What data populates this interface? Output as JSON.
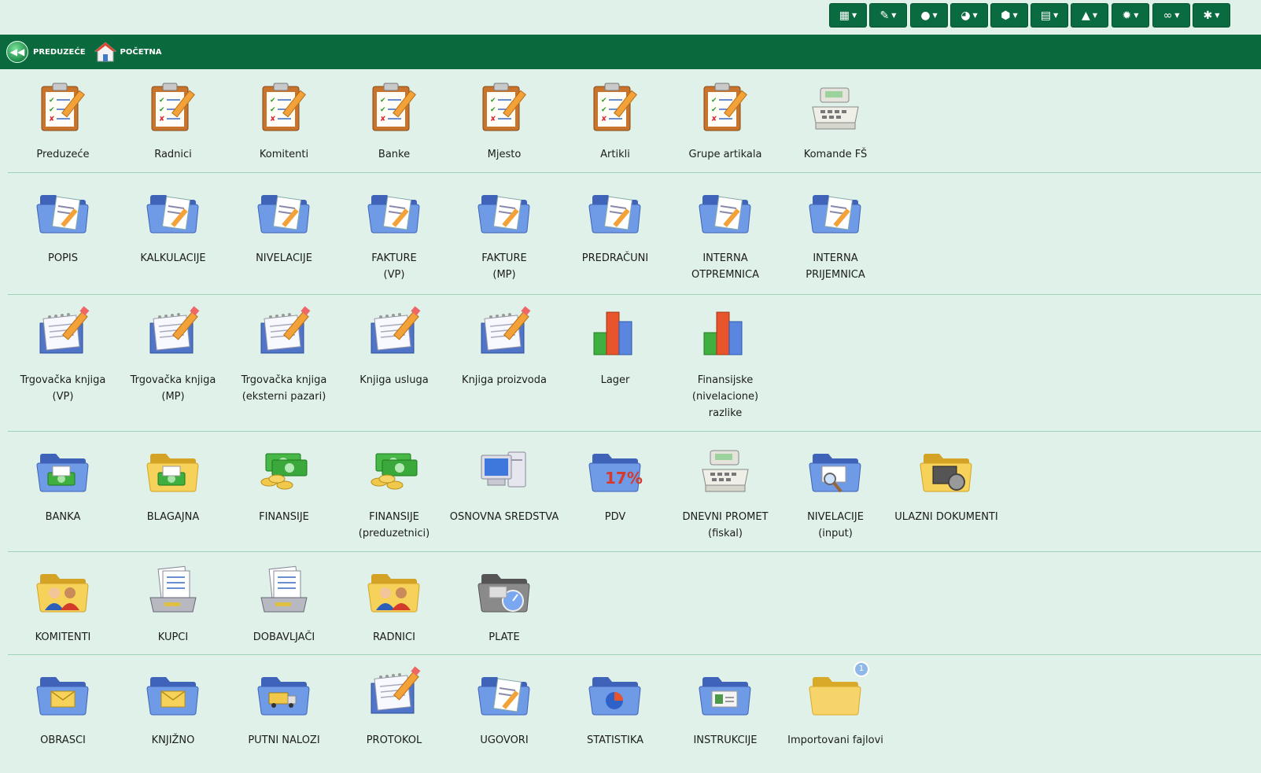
{
  "toolbar": {
    "buttons": [
      {
        "name": "calculator-menu-button",
        "icon": "calculator-icon",
        "glyph": "▦"
      },
      {
        "name": "edit-menu-button",
        "icon": "pencil-icon",
        "glyph": "✎"
      },
      {
        "name": "user-menu-button",
        "icon": "user-icon",
        "glyph": "●"
      },
      {
        "name": "chart-menu-button",
        "icon": "pie-chart-icon",
        "glyph": "◕"
      },
      {
        "name": "package-menu-button",
        "icon": "cube-icon",
        "glyph": "⬢"
      },
      {
        "name": "book-menu-button",
        "icon": "book-icon",
        "glyph": "▤"
      },
      {
        "name": "warning-menu-button",
        "icon": "warning-icon",
        "glyph": "▲"
      },
      {
        "name": "settings-menu-button",
        "icon": "gear-icon",
        "glyph": "✹"
      },
      {
        "name": "link-menu-button",
        "icon": "link-icon",
        "glyph": "∞"
      },
      {
        "name": "asterisk-menu-button",
        "icon": "asterisk-icon",
        "glyph": "✱"
      }
    ]
  },
  "nav": {
    "back_label": "PREDUZEĆE",
    "home_label": "POČETNA"
  },
  "rows": [
    {
      "items": [
        {
          "label": "Preduzeće",
          "icon": "clipboard-checklist-icon"
        },
        {
          "label": "Radnici",
          "icon": "clipboard-checklist-icon"
        },
        {
          "label": "Komitenti",
          "icon": "clipboard-checklist-icon"
        },
        {
          "label": "Banke",
          "icon": "clipboard-checklist-icon"
        },
        {
          "label": "Mjesto",
          "icon": "clipboard-checklist-icon"
        },
        {
          "label": "Artikli",
          "icon": "clipboard-checklist-icon"
        },
        {
          "label": "Grupe artikala",
          "icon": "clipboard-checklist-icon"
        },
        {
          "label": "Komande FŠ",
          "icon": "cash-register-icon"
        }
      ]
    },
    {
      "items": [
        {
          "label": "POPIS",
          "icon": "folder-document-icon"
        },
        {
          "label": "KALKULACIJE",
          "icon": "folder-document-icon"
        },
        {
          "label": "NIVELACIJE",
          "icon": "folder-document-icon"
        },
        {
          "label": "FAKTURE\n(VP)",
          "icon": "folder-document-icon"
        },
        {
          "label": "FAKTURE\n(MP)",
          "icon": "folder-document-icon"
        },
        {
          "label": "PREDRAČUNI",
          "icon": "folder-document-icon"
        },
        {
          "label": "INTERNA\nOTPREMNICA",
          "icon": "folder-document-icon"
        },
        {
          "label": "INTERNA\nPRIJEMNICA",
          "icon": "folder-document-icon"
        }
      ]
    },
    {
      "items": [
        {
          "label": "Trgovačka knjiga\n(VP)",
          "icon": "notebook-pencil-icon"
        },
        {
          "label": "Trgovačka knjiga\n(MP)",
          "icon": "notebook-pencil-icon"
        },
        {
          "label": "Trgovačka knjiga\n(eksterni pazari)",
          "icon": "notebook-pencil-icon"
        },
        {
          "label": "Knjiga usluga",
          "icon": "notebook-pencil-icon"
        },
        {
          "label": "Knjiga proizvoda",
          "icon": "notebook-pencil-icon"
        },
        {
          "label": "Lager",
          "icon": "bar-chart-icon"
        },
        {
          "label": "Finansijske\n(nivelacione)\nrazlike",
          "icon": "bar-chart-icon"
        }
      ]
    },
    {
      "items": [
        {
          "label": "BANKA",
          "icon": "folder-money-icon"
        },
        {
          "label": "BLAGAJNA",
          "icon": "folder-money-yellow-icon"
        },
        {
          "label": "FINANSIJE",
          "icon": "money-stack-icon"
        },
        {
          "label": "FINANSIJE\n(preduzetnici)",
          "icon": "money-stack-icon"
        },
        {
          "label": "OSNOVNA SREDSTVA",
          "icon": "computer-icon"
        },
        {
          "label": "PDV",
          "icon": "folder-percent-icon"
        },
        {
          "label": "DNEVNI PROMET\n(fiskal)",
          "icon": "cash-register-icon"
        },
        {
          "label": "NIVELACIJE\n(input)",
          "icon": "folder-search-icon"
        },
        {
          "label": "ULAZNI DOKUMENTI",
          "icon": "folder-media-icon"
        }
      ]
    },
    {
      "items": [
        {
          "label": "KOMITENTI",
          "icon": "folder-people-icon"
        },
        {
          "label": "KUPCI",
          "icon": "document-tray-icon"
        },
        {
          "label": "DOBAVLJAČI",
          "icon": "document-tray-icon"
        },
        {
          "label": "RADNICI",
          "icon": "folder-people-icon"
        },
        {
          "label": "PLATE",
          "icon": "folder-gauge-icon"
        }
      ]
    },
    {
      "items": [
        {
          "label": "OBRASCI",
          "icon": "folder-mail-icon"
        },
        {
          "label": "KNJIŽNO",
          "icon": "folder-mail-icon"
        },
        {
          "label": "PUTNI NALOZI",
          "icon": "folder-truck-icon"
        },
        {
          "label": "PROTOKOL",
          "icon": "notebook-pencil-icon"
        },
        {
          "label": "UGOVORI",
          "icon": "folder-document-icon"
        },
        {
          "label": "STATISTIKA",
          "icon": "folder-pie-icon"
        },
        {
          "label": "INSTRUKCIJE",
          "icon": "folder-id-icon"
        },
        {
          "label": "Importovani fajlovi",
          "icon": "folder-badge-icon",
          "badge": "1"
        }
      ]
    }
  ]
}
